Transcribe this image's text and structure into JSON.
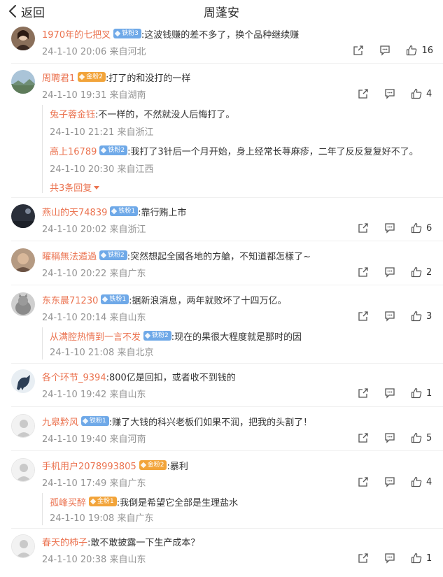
{
  "header": {
    "back_label": "返回",
    "title": "周蓬安"
  },
  "colors": {
    "username": "#eb7350",
    "meta": "#939393",
    "fan_badge": "#6fa9e8",
    "gold_badge": "#f2a43a"
  },
  "comments": [
    {
      "user": "1970年的七把叉",
      "badge": "铁粉3",
      "text": ":这波钱赚的差不多了，换个品种继续赚",
      "time": "24-1-10 20:06",
      "location": "来自河北",
      "likes": "16"
    },
    {
      "user": "周聘君1",
      "badge": "金粉2",
      "text": ":打了的和没打的一样",
      "time": "24-1-10 19:31",
      "location": "来自湖南",
      "likes": "4",
      "replies": [
        {
          "user": "兔子蓉金钰",
          "text": ":不一样的，不然就没人后悔打了。",
          "time": "24-1-10 21:21",
          "location": "来自浙江"
        },
        {
          "user": "高上16789",
          "badge": "铁粉2",
          "text": ":我打了3针后一个月开始，身上经常长荨麻疹，二年了反反复复好不了。",
          "time": "24-1-10 20:30",
          "location": "来自江西"
        }
      ],
      "more_replies": "共3条回复"
    },
    {
      "user": "燕山的天74839",
      "badge": "铁粉1",
      "text": ":靠行贿上市",
      "time": "24-1-10 20:02",
      "location": "来自浙江",
      "likes": "6"
    },
    {
      "user": "曜稱無法遁過",
      "badge": "铁粉2",
      "text": ":突然想起全國各地的方艙，不知道都怎樣了~",
      "time": "24-1-10 20:22",
      "location": "来自广东",
      "likes": "2"
    },
    {
      "user": "东东晨71230",
      "badge": "铁粉1",
      "text": ":据新浪消息，两年就败坏了十四万亿。",
      "time": "24-1-10 20:14",
      "location": "来自山东",
      "likes": "3",
      "replies": [
        {
          "user": "从满腔热情到一言不发",
          "badge": "铁粉2",
          "text": ":现在的果很大程度就是那时的因",
          "time": "24-1-10 21:08",
          "location": "来自北京"
        }
      ]
    },
    {
      "user": "各个环节_9394",
      "text": ":800亿是回扣，或者收不到钱的",
      "time": "24-1-10 19:42",
      "location": "来自山东",
      "likes": "1"
    },
    {
      "user": "九皋黔风",
      "badge": "铁粉1",
      "text": ":赚了大钱的科兴老板们如果不润，把我的头割了！",
      "time": "24-1-10 19:40",
      "location": "来自河南",
      "likes": "5"
    },
    {
      "user": "手机用户2078993805",
      "badge": "金粉2",
      "text": ":暴利",
      "time": "24-1-10 17:49",
      "location": "来自广东",
      "likes": "4",
      "replies": [
        {
          "user": "孤峰买醉",
          "badge": "金粉1",
          "text": ":我倒是希望它全部是生理盐水",
          "time": "24-1-10 19:08",
          "location": "来自广东"
        }
      ]
    },
    {
      "user": "春天的柿子",
      "text": ":敢不敢披露一下生产成本？",
      "time": "24-1-10 20:38",
      "location": "来自山东",
      "likes": "1"
    }
  ]
}
